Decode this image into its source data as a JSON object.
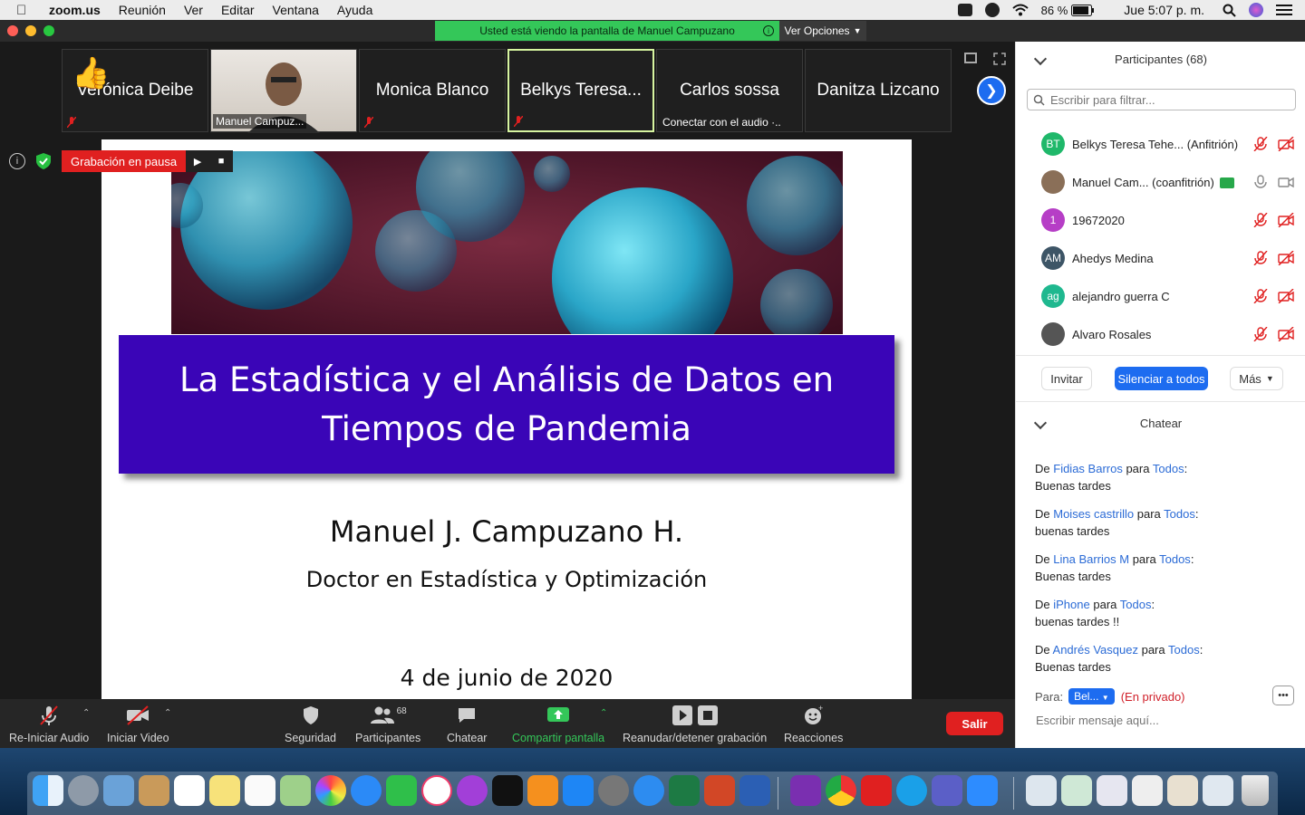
{
  "menubar": {
    "app": "zoom.us",
    "items": [
      "Reunión",
      "Ver",
      "Editar",
      "Ventana",
      "Ayuda"
    ],
    "battery": "86 %",
    "clock": "Jue 5:07 p. m."
  },
  "window": {
    "banner": "Usted está viendo la pantalla de Manuel Campuzano",
    "view_options": "Ver Opciones"
  },
  "thumbnails": [
    {
      "name": "Verónica Deibe",
      "sub": ""
    },
    {
      "name": "",
      "sub": "Manuel Campuz..."
    },
    {
      "name": "Monica Blanco",
      "sub": ""
    },
    {
      "name": "Belkys Teresa...",
      "sub": ""
    },
    {
      "name": "Carlos sossa",
      "sub": "Conectar con el audio ·.."
    },
    {
      "name": "Danitza Lizcano",
      "sub": ""
    }
  ],
  "recording": {
    "label": "Grabación en pausa"
  },
  "slide": {
    "title_line1": "La Estadística y el Análisis de Datos en",
    "title_line2": "Tiempos de Pandemia",
    "author": "Manuel J. Campuzano H.",
    "degree": "Doctor en Estadística y Optimización",
    "date": "4 de junio de 2020"
  },
  "toolbar": {
    "audio": "Re-Iniciar Audio",
    "video": "Iniciar Video",
    "security": "Seguridad",
    "participants": "Participantes",
    "participants_count": "68",
    "chat": "Chatear",
    "share": "Compartir pantalla",
    "recording": "Reanudar/detener grabación",
    "reactions": "Reacciones",
    "leave": "Salir"
  },
  "participants_panel": {
    "title": "Participantes (68)",
    "filter_placeholder": "Escribir para filtrar...",
    "list": [
      {
        "initials": "BT",
        "name": "Belkys Teresa Tehe... (Anfitrión)",
        "color": "#1fb86a"
      },
      {
        "initials": "",
        "name": "Manuel Cam... (coanfitrión)",
        "color": "#8a6f58"
      },
      {
        "initials": "1",
        "name": "19672020",
        "color": "#b63ec6"
      },
      {
        "initials": "AM",
        "name": "Ahedys Medina",
        "color": "#3d5566"
      },
      {
        "initials": "ag",
        "name": "alejandro guerra C",
        "color": "#1fb88f"
      },
      {
        "initials": "",
        "name": "Alvaro Rosales",
        "color": "#555555"
      }
    ],
    "invite": "Invitar",
    "mute_all": "Silenciar a todos",
    "more": "Más"
  },
  "chat_panel": {
    "title": "Chatear",
    "messages": [
      {
        "from": "Fidias Barros",
        "to": "Todos",
        "text": "Buenas tardes"
      },
      {
        "from": "Moises castrillo",
        "to": "Todos",
        "text": "buenas tardes"
      },
      {
        "from": "Lina Barrios M",
        "to": "Todos",
        "text": "Buenas tardes"
      },
      {
        "from": "iPhone",
        "to": "Todos",
        "text": "buenas tardes !!"
      },
      {
        "from": "Andrés Vasquez",
        "to": "Todos",
        "text": "Buenas tardes"
      }
    ],
    "de": "De",
    "para_word": "para",
    "to_label": "Para:",
    "to_value": "Bel...",
    "private": "(En privado)",
    "input_placeholder": "Escribir mensaje aquí..."
  },
  "colors": {
    "accent": "#1d6cf0",
    "leave": "#e02020",
    "slide_title_bg": "#3a05b7",
    "share_green": "#34c759"
  }
}
